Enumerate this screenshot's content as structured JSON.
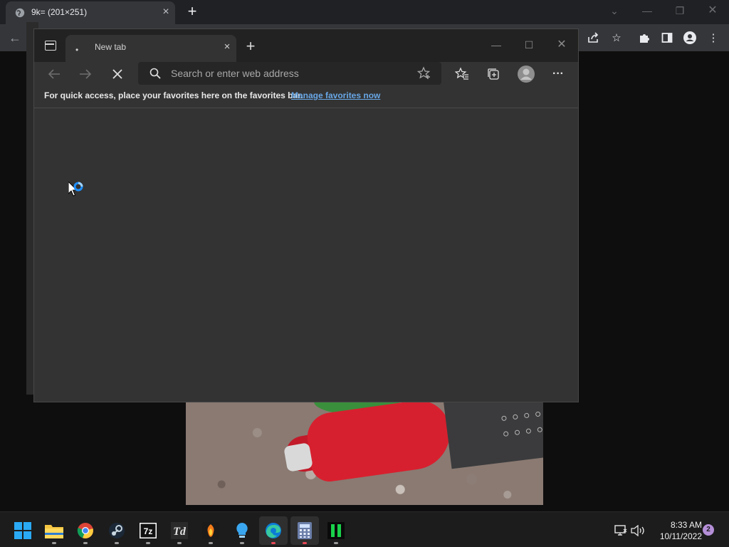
{
  "chrome": {
    "tab_title": "9k= (201×251)",
    "tab_close": "×",
    "new_tab": "+",
    "back": "←"
  },
  "edge": {
    "tab_title": "New tab",
    "tab_loading_dot": "•",
    "tab_close": "×",
    "new_tab": "+",
    "address_placeholder": "Search or enter web address",
    "favorites_message": "For quick access, place your favorites here on the favorites bar.",
    "favorites_link": "Manage favorites now",
    "more_label": "···"
  },
  "taskbar": {
    "apps": [
      "start-menu",
      "file-explorer",
      "google-chrome",
      "steam",
      "7-zip",
      "typedown",
      "firewall-app",
      "tips",
      "microsoft-edge",
      "calculator",
      "terminal-app"
    ],
    "clock_time": "8:33 AM",
    "clock_date": "10/11/2022",
    "notification_count": "2"
  },
  "colors": {
    "edge_frame": "#222222",
    "edge_content": "#333333",
    "link": "#68a7e6",
    "accent": "#0078d4"
  }
}
